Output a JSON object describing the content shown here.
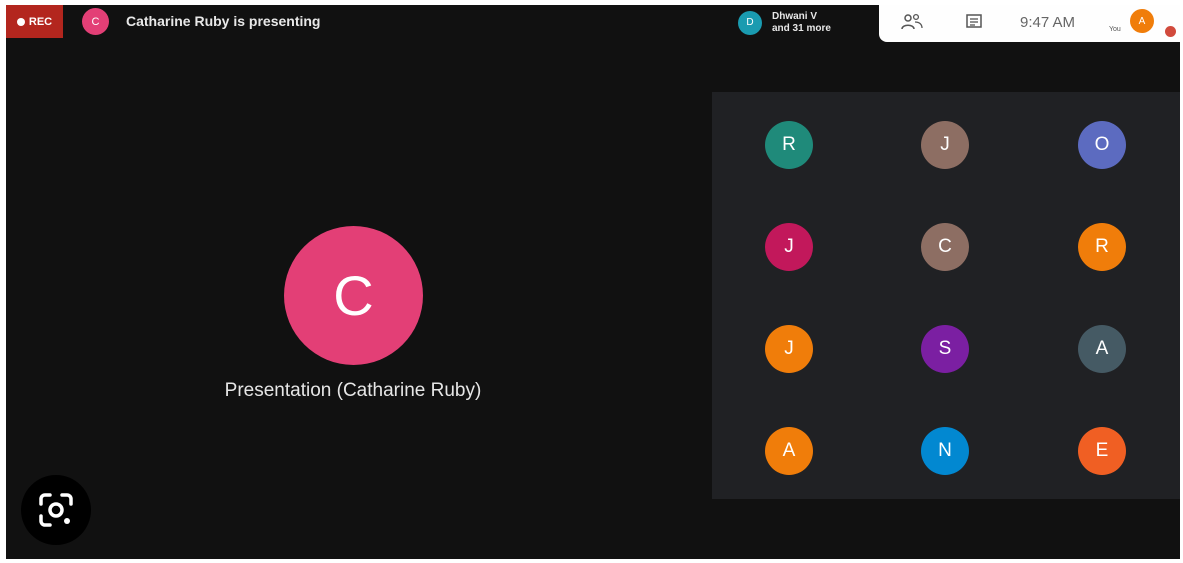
{
  "recording": {
    "label": "REC",
    "color": "#b3261e"
  },
  "presenter": {
    "initial": "C",
    "color": "#e33f76",
    "banner_text": "Catharine Ruby is presenting"
  },
  "participants_chip": {
    "initial": "D",
    "color": "#1a9bb0",
    "line1": "Dhwani V",
    "line2": "and 31 more"
  },
  "toolbar": {
    "people_icon": "people-icon",
    "chat_icon": "chat-icon",
    "time": "9:47 AM",
    "self": {
      "label": "You",
      "initial": "A",
      "color": "#f07d0a"
    }
  },
  "main": {
    "avatar_initial": "C",
    "avatar_color": "#e33f76",
    "label": "Presentation (Catharine Ruby)"
  },
  "grid": [
    {
      "initial": "R",
      "color": "#1f8a7a"
    },
    {
      "initial": "J",
      "color": "#8d6e63"
    },
    {
      "initial": "O",
      "color": "#5c6bc0"
    },
    {
      "initial": "J",
      "color": "#c2185b"
    },
    {
      "initial": "C",
      "color": "#8d6e63"
    },
    {
      "initial": "R",
      "color": "#f07d0a"
    },
    {
      "initial": "J",
      "color": "#f07d0a"
    },
    {
      "initial": "S",
      "color": "#7b1fa2"
    },
    {
      "initial": "A",
      "color": "#455a64"
    },
    {
      "initial": "A",
      "color": "#f07d0a"
    },
    {
      "initial": "N",
      "color": "#0288d1"
    },
    {
      "initial": "E",
      "color": "#f05f23"
    }
  ],
  "lens_button": {
    "icon": "google-lens-icon"
  }
}
